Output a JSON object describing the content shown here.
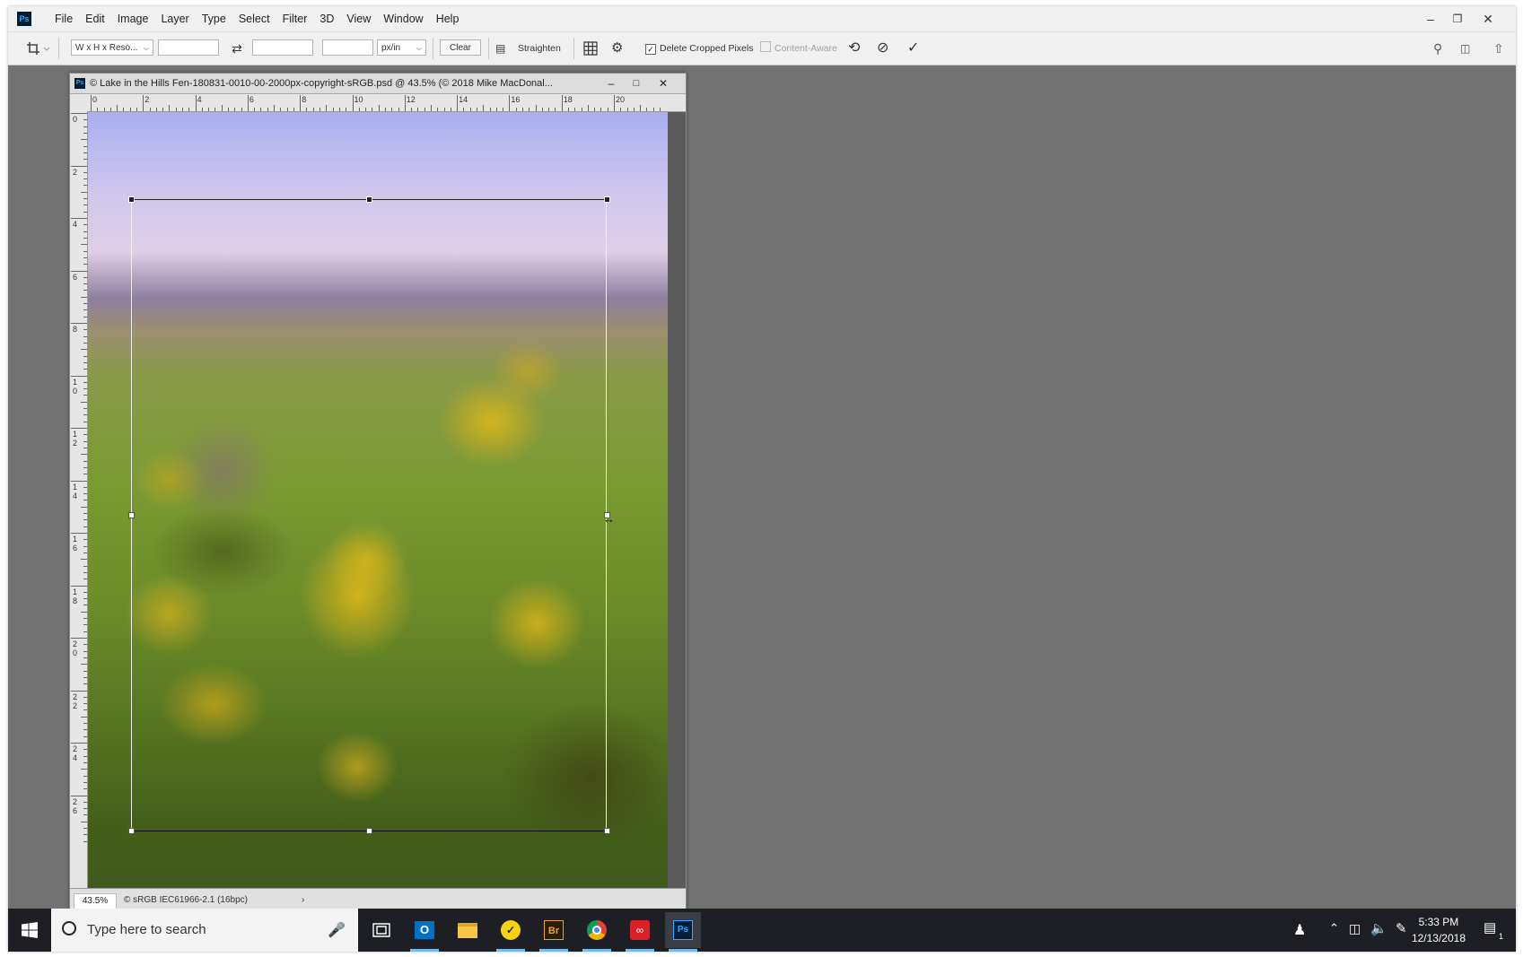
{
  "app": {
    "logo": "Ps"
  },
  "menu": [
    "File",
    "Edit",
    "Image",
    "Layer",
    "Type",
    "Select",
    "Filter",
    "3D",
    "View",
    "Window",
    "Help"
  ],
  "window_controls": {
    "minimize": "–",
    "restore": "❐",
    "close": "✕"
  },
  "options_bar": {
    "ratio_preset": "W x H x Reso...",
    "width_value": "",
    "height_value": "",
    "resolution_value": "",
    "units": "px/in",
    "clear_label": "Clear",
    "straighten_label": "Straighten",
    "delete_cropped_label": "Delete Cropped Pixels",
    "delete_cropped_checked": true,
    "content_aware_label": "Content-Aware",
    "content_aware_checked": false
  },
  "document": {
    "title": "© Lake in the Hills Fen-180831-0010-00-2000px-copyright-sRGB.psd @ 43.5% (© 2018 Mike MacDonal...",
    "zoom": "43.5%",
    "profile": "© sRGB IEC61966-2.1 (16bpc)",
    "ruler_top": [
      "0",
      "2",
      "4",
      "6",
      "8",
      "10",
      "12",
      "14",
      "16",
      "18",
      "20"
    ],
    "ruler_left": [
      "0",
      "2",
      "4",
      "6",
      "8",
      "10",
      "12",
      "14",
      "16",
      "18",
      "20",
      "22",
      "24",
      "26"
    ]
  },
  "taskbar": {
    "search_placeholder": "Type here to search",
    "time": "5:33 PM",
    "date": "12/13/2018",
    "notification_count": "1"
  }
}
